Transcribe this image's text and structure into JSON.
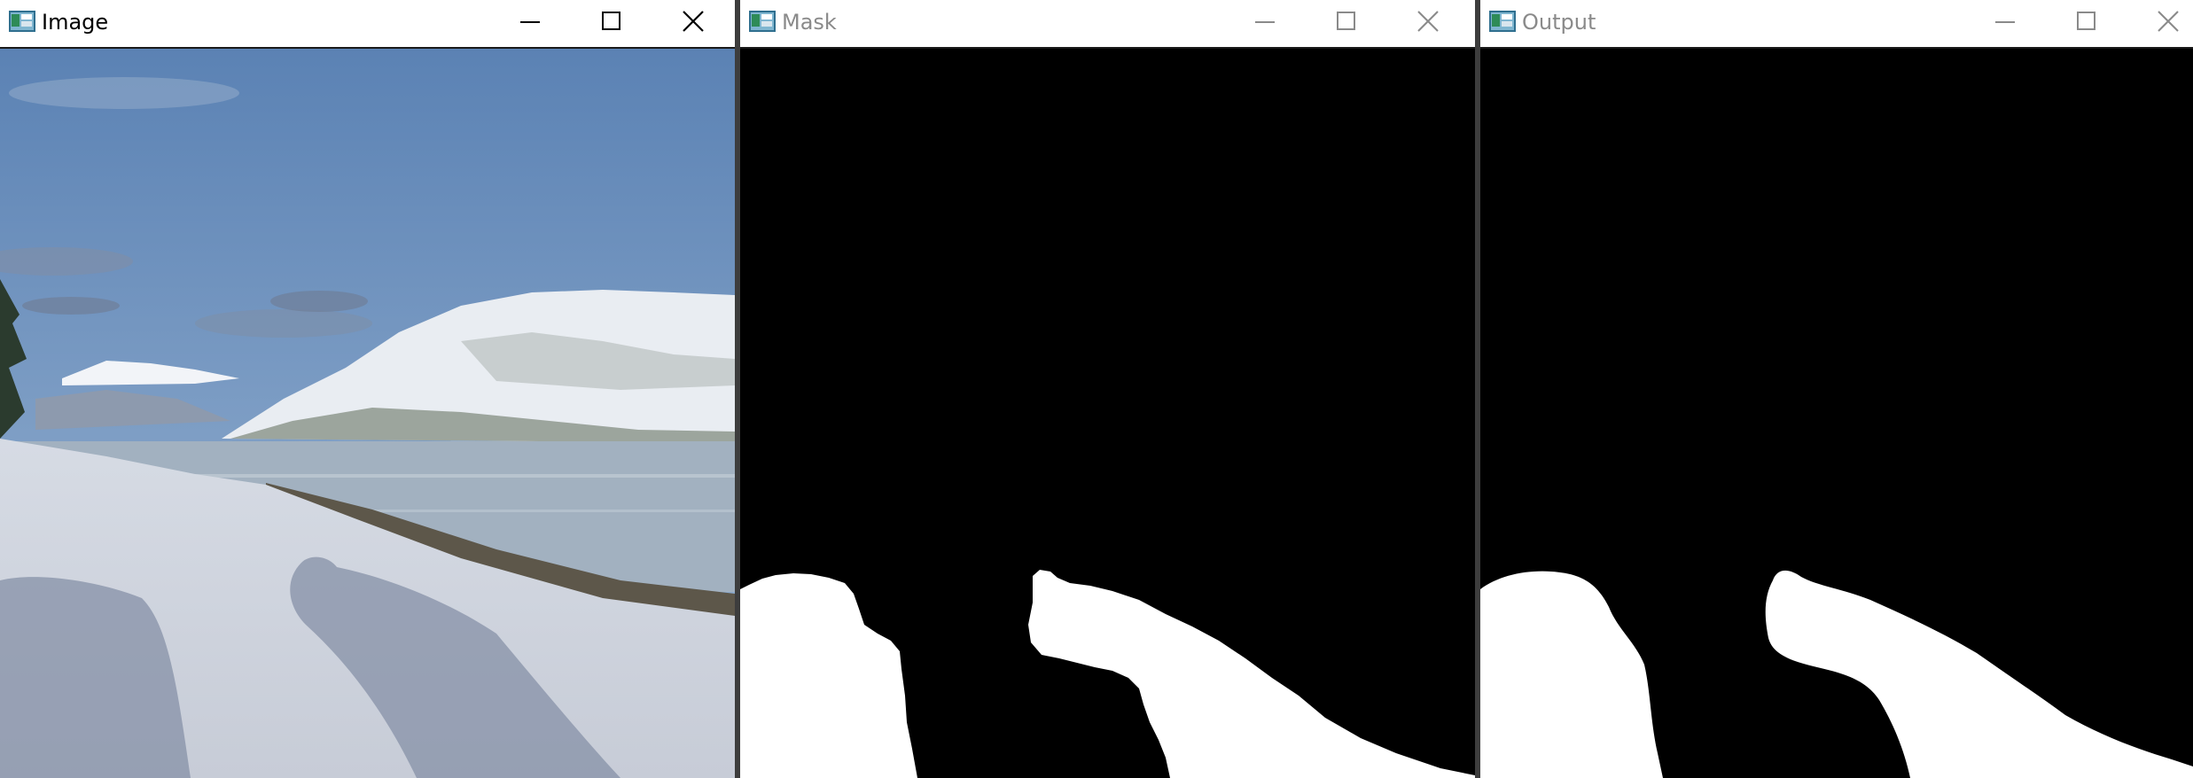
{
  "windows": [
    {
      "title": "Image",
      "active": true
    },
    {
      "title": "Mask",
      "active": false
    },
    {
      "title": "Output",
      "active": false
    }
  ],
  "colors": {
    "title_active": "#000000",
    "title_inactive": "#8a8a8a",
    "mask_background": "#000000",
    "mask_foreground": "#ffffff",
    "sky": "#6f93bd",
    "snow": "#e3e7ee",
    "water": "#a9b4bd"
  },
  "icons": {
    "app": "app-window-icon",
    "minimize": "minimize-icon",
    "maximize": "maximize-icon",
    "close": "close-icon"
  }
}
